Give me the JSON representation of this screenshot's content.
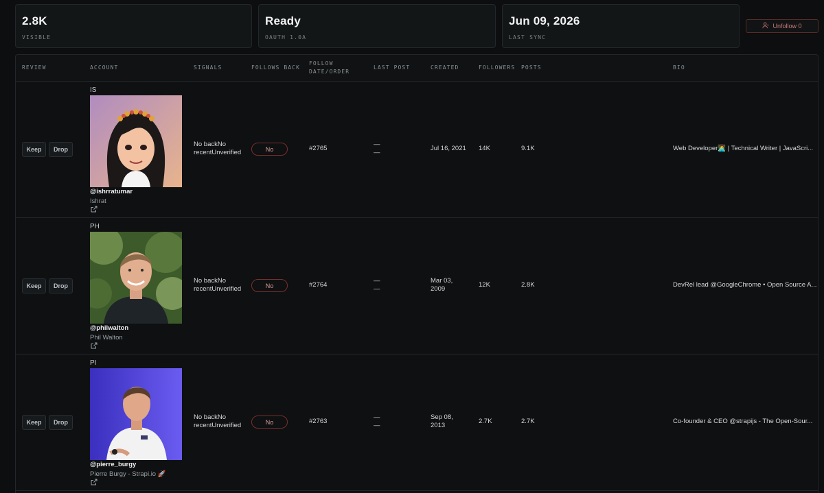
{
  "stats": [
    {
      "value": "2.8K",
      "label": "VISIBLE"
    },
    {
      "value": "Ready",
      "label": "OAUTH 1.0A"
    },
    {
      "value": "Jun 09, 2026",
      "label": "LAST SYNC"
    }
  ],
  "unfollow": {
    "label": "Unfollow 0",
    "icon": "user-minus-icon"
  },
  "columns": {
    "review": "REVIEW",
    "account": "ACCOUNT",
    "signals": "SIGNALS",
    "follows_back": "FOLLOWS BACK",
    "follow_order_1": "FOLLOW",
    "follow_order_2": "DATE/ORDER",
    "last_post": "LAST POST",
    "created": "CREATED",
    "followers": "FOLLOWERS",
    "posts": "POSTS",
    "bio": "BIO"
  },
  "rows": [
    {
      "keep_label": "Keep",
      "drop_label": "Drop",
      "initials": "IS",
      "handle": "@ishrratumar",
      "name": "Ishrat",
      "signals_1": "No backNo",
      "signals_2": "recentUnverified",
      "follows_back": "No",
      "order": "#2765",
      "last_post_1": "—",
      "last_post_2": "—",
      "created_1": "Jul 16, 2021",
      "created_2": "",
      "followers": "14K",
      "posts": "9.1K",
      "bio": "Web Developer👩‍💻 | Technical Writer | JavaScri..."
    },
    {
      "keep_label": "Keep",
      "drop_label": "Drop",
      "initials": "PH",
      "handle": "@philwalton",
      "name": "Phil Walton",
      "signals_1": "No backNo",
      "signals_2": "recentUnverified",
      "follows_back": "No",
      "order": "#2764",
      "last_post_1": "—",
      "last_post_2": "—",
      "created_1": "Mar 03,",
      "created_2": "2009",
      "followers": "12K",
      "posts": "2.8K",
      "bio": "DevRel lead @GoogleChrome • Open Source A..."
    },
    {
      "keep_label": "Keep",
      "drop_label": "Drop",
      "initials": "PI",
      "handle": "@pierre_burgy",
      "name": "Pierre Burgy - Strapi.io 🚀",
      "signals_1": "No backNo",
      "signals_2": "recentUnverified",
      "follows_back": "No",
      "order": "#2763",
      "last_post_1": "—",
      "last_post_2": "—",
      "created_1": "Sep 08,",
      "created_2": "2013",
      "followers": "2.7K",
      "posts": "2.7K",
      "bio": "Co-founder & CEO @strapijs - The Open-Sour..."
    }
  ]
}
